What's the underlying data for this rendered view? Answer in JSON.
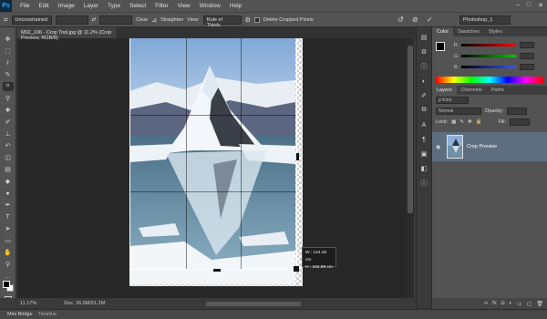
{
  "app": {
    "logo": "Ps"
  },
  "menu": [
    "File",
    "Edit",
    "Image",
    "Layer",
    "Type",
    "Select",
    "Filter",
    "View",
    "Window",
    "Help"
  ],
  "window_controls": [
    "–",
    "□",
    "✕"
  ],
  "options": {
    "ratio": "Unconstrained",
    "swap_symbol": "⇄",
    "clear_label": "Clear",
    "straighten_label": "Straighten",
    "view_label": "View:",
    "view_value": "Rule of Thirds",
    "delete_cropped_label": "Delete Cropped Pixels",
    "workspace": "Photoshop_1"
  },
  "document": {
    "tab_title": "M02_106 - Crop Tool.jpg @ 11.2% (Crop Preview, RGB/8)",
    "dimension_tooltip": {
      "w": "W : 124.46 cm",
      "h": "H : 182.88 cm"
    }
  },
  "status": {
    "zoom": "11.17%",
    "doc": "Doc: 36.6M/51.2M"
  },
  "bottom_tabs": [
    "Mini Bridge",
    "Timeline"
  ],
  "panels": {
    "color_tabs": [
      "Color",
      "Swatches",
      "Styles"
    ],
    "sliders": [
      {
        "label": "R",
        "color": "#ff0000"
      },
      {
        "label": "G",
        "color": "#00cc00"
      },
      {
        "label": "B",
        "color": "#3355ff"
      }
    ],
    "layer_tabs": [
      "Layers",
      "Channels",
      "Paths"
    ],
    "kind_label": "ρ Kind",
    "blend_mode": "Normal",
    "opacity_label": "Opacity:",
    "lock_label": "Lock:",
    "fill_label": "Fill:",
    "layer_name": "Crop Preview"
  }
}
